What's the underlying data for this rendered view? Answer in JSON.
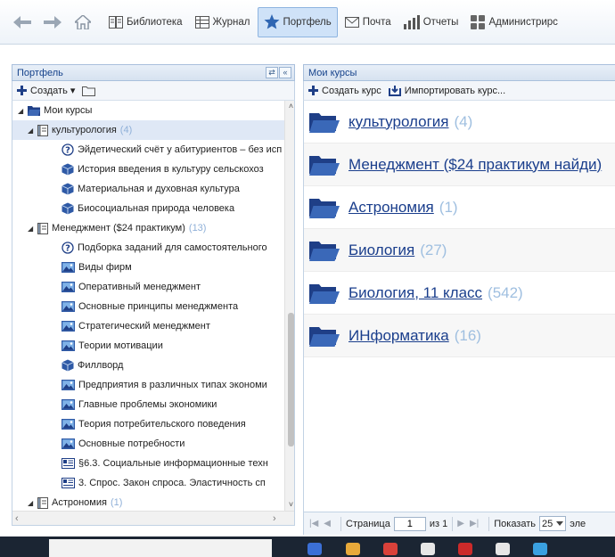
{
  "toolbar": {
    "items": [
      {
        "label": "Библиотека",
        "icon": "library-icon"
      },
      {
        "label": "Журнал",
        "icon": "journal-icon"
      },
      {
        "label": "Портфель",
        "icon": "star-icon",
        "active": true
      },
      {
        "label": "Почта",
        "icon": "mail-icon"
      },
      {
        "label": "Отчеты",
        "icon": "bar-chart-icon"
      },
      {
        "label": "Администрирс",
        "icon": "admin-icon"
      }
    ]
  },
  "left_panel": {
    "title": "Портфель",
    "create_label": "Создать ▾"
  },
  "tree": {
    "rows": [
      {
        "label": "Мои курсы",
        "count": "",
        "level": 0,
        "icon": "folder-icon",
        "expander": true,
        "selected": false
      },
      {
        "label": "культурология",
        "count": "(4)",
        "level": 1,
        "icon": "course-icon",
        "expander": true,
        "selected": true
      },
      {
        "label": "Эйдетический счёт у абитуриентов – без исп",
        "count": "",
        "level": 2,
        "icon": "quiz-icon",
        "expander": false,
        "selected": false
      },
      {
        "label": "История введения в культуру сельскохоз",
        "count": "",
        "level": 2,
        "icon": "package-icon",
        "expander": false,
        "selected": false
      },
      {
        "label": "Материальная и духовная культура",
        "count": "",
        "level": 2,
        "icon": "package-icon",
        "expander": false,
        "selected": false
      },
      {
        "label": "Биосоциальная природа человека",
        "count": "",
        "level": 2,
        "icon": "package-icon",
        "expander": false,
        "selected": false
      },
      {
        "label": "Менеджмент ($24 практикум)",
        "count": "(13)",
        "level": 1,
        "icon": "course-icon",
        "expander": true,
        "selected": false
      },
      {
        "label": "Подборка заданий для самостоятельного",
        "count": "",
        "level": 2,
        "icon": "quiz-icon",
        "expander": false,
        "selected": false
      },
      {
        "label": "Виды фирм",
        "count": "",
        "level": 2,
        "icon": "image-icon",
        "expander": false,
        "selected": false
      },
      {
        "label": "Оперативный менеджмент",
        "count": "",
        "level": 2,
        "icon": "image-icon",
        "expander": false,
        "selected": false
      },
      {
        "label": "Основные принципы менеджмента",
        "count": "",
        "level": 2,
        "icon": "image-icon",
        "expander": false,
        "selected": false
      },
      {
        "label": "Стратегический менеджмент",
        "count": "",
        "level": 2,
        "icon": "image-icon",
        "expander": false,
        "selected": false
      },
      {
        "label": "Теории мотивации",
        "count": "",
        "level": 2,
        "icon": "image-icon",
        "expander": false,
        "selected": false
      },
      {
        "label": "Филлворд",
        "count": "",
        "level": 2,
        "icon": "package-icon",
        "expander": false,
        "selected": false
      },
      {
        "label": "Предприятия в различных типах экономи",
        "count": "",
        "level": 2,
        "icon": "image-icon",
        "expander": false,
        "selected": false
      },
      {
        "label": "Главные проблемы экономики",
        "count": "",
        "level": 2,
        "icon": "image-icon",
        "expander": false,
        "selected": false
      },
      {
        "label": "Теория потребительского поведения",
        "count": "",
        "level": 2,
        "icon": "image-icon",
        "expander": false,
        "selected": false
      },
      {
        "label": "Основные потребности",
        "count": "",
        "level": 2,
        "icon": "image-icon",
        "expander": false,
        "selected": false
      },
      {
        "label": "§6.3. Социальные информационные техн",
        "count": "",
        "level": 2,
        "icon": "document-icon",
        "expander": false,
        "selected": false
      },
      {
        "label": "3. Спрос. Закон спроса. Эластичность сп",
        "count": "",
        "level": 2,
        "icon": "document-icon",
        "expander": false,
        "selected": false
      },
      {
        "label": "Астрономия",
        "count": "(1)",
        "level": 1,
        "icon": "course-icon",
        "expander": true,
        "selected": false
      }
    ]
  },
  "right_panel": {
    "title": "Мои курсы",
    "create_course_label": "Создать курс",
    "import_course_label": "Импортировать курс...",
    "courses": [
      {
        "label": "культурология",
        "count": "(4)"
      },
      {
        "label": "Менеджмент ($24 практикум найди)",
        "count": ""
      },
      {
        "label": "Астрономия",
        "count": "(1)"
      },
      {
        "label": "Биология",
        "count": "(27)"
      },
      {
        "label": "Биология, 11 класс",
        "count": "(542)"
      },
      {
        "label": "ИНформатика",
        "count": "(16)"
      }
    ]
  },
  "pager": {
    "page_label": "Страница",
    "page_value": "1",
    "of_label": "из 1",
    "show_label": "Показать",
    "page_size": "25",
    "items_label": "эле"
  },
  "colors": {
    "accent": "#15428b",
    "link": "#1a3e8c",
    "count": "#8fb0d8",
    "folder": "#1f3f87"
  }
}
